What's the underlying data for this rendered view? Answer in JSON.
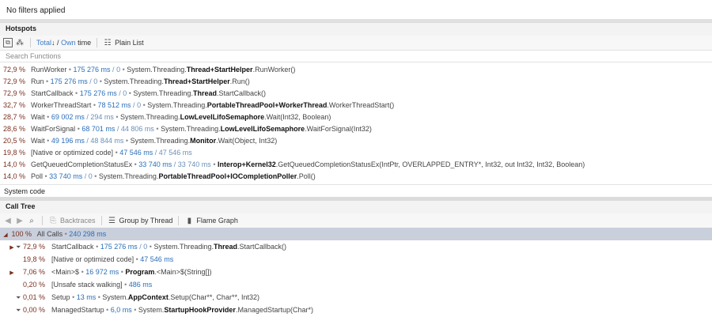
{
  "filters": {
    "label": "No filters applied"
  },
  "hotspots": {
    "title": "Hotspots",
    "toolbar": {
      "total": "Total",
      "arrow": "↓",
      "slash": "/",
      "own": "Own",
      "time": "time",
      "plain_list": "Plain List"
    },
    "search_placeholder": "Search Functions",
    "rows": [
      {
        "pct": "72,9 %",
        "name": "RunWorker",
        "total": "175 276 ms",
        "own": "0",
        "ns": "System.Threading.",
        "cls": "Thread+StartHelper",
        "method": ".RunWorker()"
      },
      {
        "pct": "72,9 %",
        "name": "Run",
        "total": "175 276 ms",
        "own": "0",
        "ns": "System.Threading.",
        "cls": "Thread+StartHelper",
        "method": ".Run()"
      },
      {
        "pct": "72,9 %",
        "name": "StartCallback",
        "total": "175 276 ms",
        "own": "0",
        "ns": "System.Threading.",
        "cls": "Thread",
        "method": ".StartCallback()"
      },
      {
        "pct": "32,7 %",
        "name": "WorkerThreadStart",
        "total": "78 512 ms",
        "own": "0",
        "ns": "System.Threading.",
        "cls": "PortableThreadPool+WorkerThread",
        "method": ".WorkerThreadStart()"
      },
      {
        "pct": "28,7 %",
        "name": "Wait",
        "total": "69 002 ms",
        "own": "294 ms",
        "ns": "System.Threading.",
        "cls": "LowLevelLifoSemaphore",
        "method": ".Wait(Int32, Boolean)"
      },
      {
        "pct": "28,6 %",
        "name": "WaitForSignal",
        "total": "68 701 ms",
        "own": "44 806 ms",
        "ns": "System.Threading.",
        "cls": "LowLevelLifoSemaphore",
        "method": ".WaitForSignal(Int32)"
      },
      {
        "pct": "20,5 %",
        "name": "Wait",
        "total": "49 196 ms",
        "own": "48 844 ms",
        "ns": "System.Threading.",
        "cls": "Monitor",
        "method": ".Wait(Object, Int32)"
      },
      {
        "pct": "19,8 %",
        "name": "[Native or optimized code]",
        "total": "47 546 ms",
        "own": "47 546 ms",
        "ns": "",
        "cls": "",
        "method": ""
      },
      {
        "pct": "14,0 %",
        "name": "GetQueuedCompletionStatusEx",
        "total": "33 740 ms",
        "own": "33 740 ms",
        "ns": "",
        "cls": "Interop+Kernel32",
        "method": ".GetQueuedCompletionStatusEx(IntPtr, OVERLAPPED_ENTRY*, Int32, out Int32, Int32, Boolean)"
      },
      {
        "pct": "14,0 %",
        "name": "Poll",
        "total": "33 740 ms",
        "own": "0",
        "ns": "System.Threading.",
        "cls": "PortableThreadPool+IOCompletionPoller",
        "method": ".Poll()"
      }
    ]
  },
  "system_code": {
    "label": "System code"
  },
  "call_tree": {
    "title": "Call Tree",
    "toolbar": {
      "backtraces": "Backtraces",
      "group_by_thread": "Group by Thread",
      "flame_graph": "Flame Graph"
    },
    "root": {
      "pct": "100 %",
      "name": "All Calls",
      "total": "240 298 ms"
    },
    "rows": [
      {
        "pct": "72,9 %",
        "name": "StartCallback",
        "total": "175 276 ms",
        "own": "0",
        "ns": "System.Threading.",
        "cls": "Thread",
        "method": ".StartCallback()",
        "expand": true,
        "filter": true
      },
      {
        "pct": "19,8 %",
        "name": "[Native or optimized code]",
        "total": "47 546 ms",
        "own": "",
        "ns": "",
        "cls": "",
        "method": "",
        "expand": false,
        "filter": false
      },
      {
        "pct": "7,06 %",
        "name": "<Main>$",
        "total": "16 972 ms",
        "own": "",
        "ns": "",
        "cls": "Program",
        "method": ".<Main>$(String[])",
        "expand": true,
        "filter": false
      },
      {
        "pct": "0,20 %",
        "name": "[Unsafe stack walking]",
        "total": "486 ms",
        "own": "",
        "ns": "",
        "cls": "",
        "method": "",
        "expand": false,
        "filter": false
      },
      {
        "pct": "0,01 %",
        "name": "Setup",
        "total": "13 ms",
        "own": "",
        "ns": "System.",
        "cls": "AppContext",
        "method": ".Setup(Char**, Char**, Int32)",
        "expand": false,
        "filter": true
      },
      {
        "pct": "0,00 %",
        "name": "ManagedStartup",
        "total": "6,0 ms",
        "own": "",
        "ns": "System.",
        "cls": "StartupHookProvider",
        "method": ".ManagedStartup(Char*)",
        "expand": false,
        "filter": true
      }
    ]
  }
}
